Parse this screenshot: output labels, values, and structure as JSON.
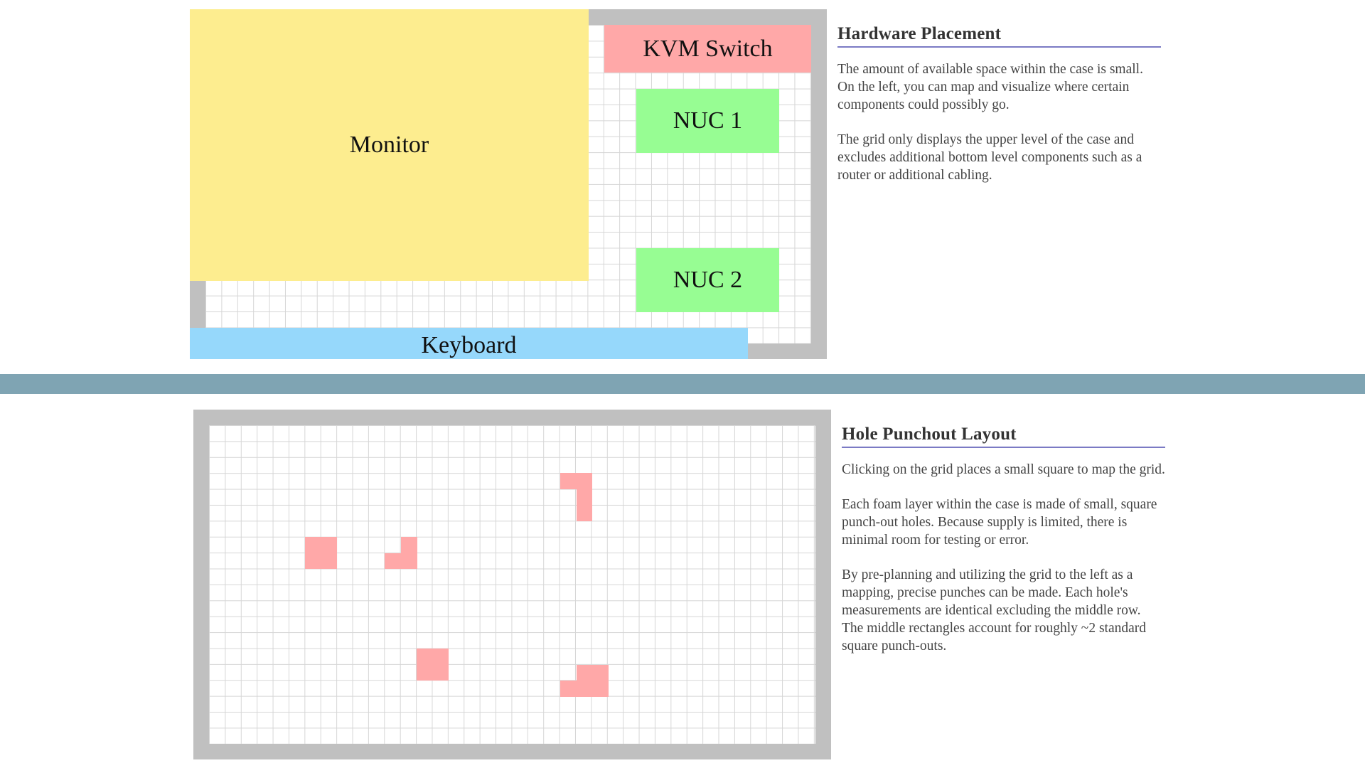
{
  "hardware": {
    "heading": "Hardware Placement",
    "paragraphs": [
      "The amount of available space within the case is small. On the left, you can map and visualize where certain components could possibly go.",
      "The grid only displays the upper level of the case and excludes additional bottom level components such as a router or additional cabling."
    ],
    "components": {
      "monitor": "Monitor",
      "kvm": "KVM Switch",
      "nuc1": "NUC 1",
      "nuc2": "NUC 2",
      "keyboard": "Keyboard"
    }
  },
  "punchout": {
    "heading": "Hole Punchout Layout",
    "paragraphs": [
      "Clicking on the grid places a small square to map the grid.",
      "Each foam layer within the case is made of small, square punch-out holes. Because supply is limited, there is minimal room for testing or error.",
      "By pre-planning and utilizing the grid to the left as a mapping, precise punches can be made. Each hole's measurements are identical excluding the middle row. The middle rectangles account for roughly ~2 standard square punch-outs."
    ]
  },
  "colors": {
    "monitor": "#fded8f",
    "kvm_switch": "#ffa8a8",
    "nuc": "#97fd93",
    "keyboard": "#96d8fb",
    "punch_square": "#ffa8a8",
    "case_border": "#c0c0c0",
    "divider": "#7fa4b3",
    "heading_rule": "#7b7ac4"
  }
}
